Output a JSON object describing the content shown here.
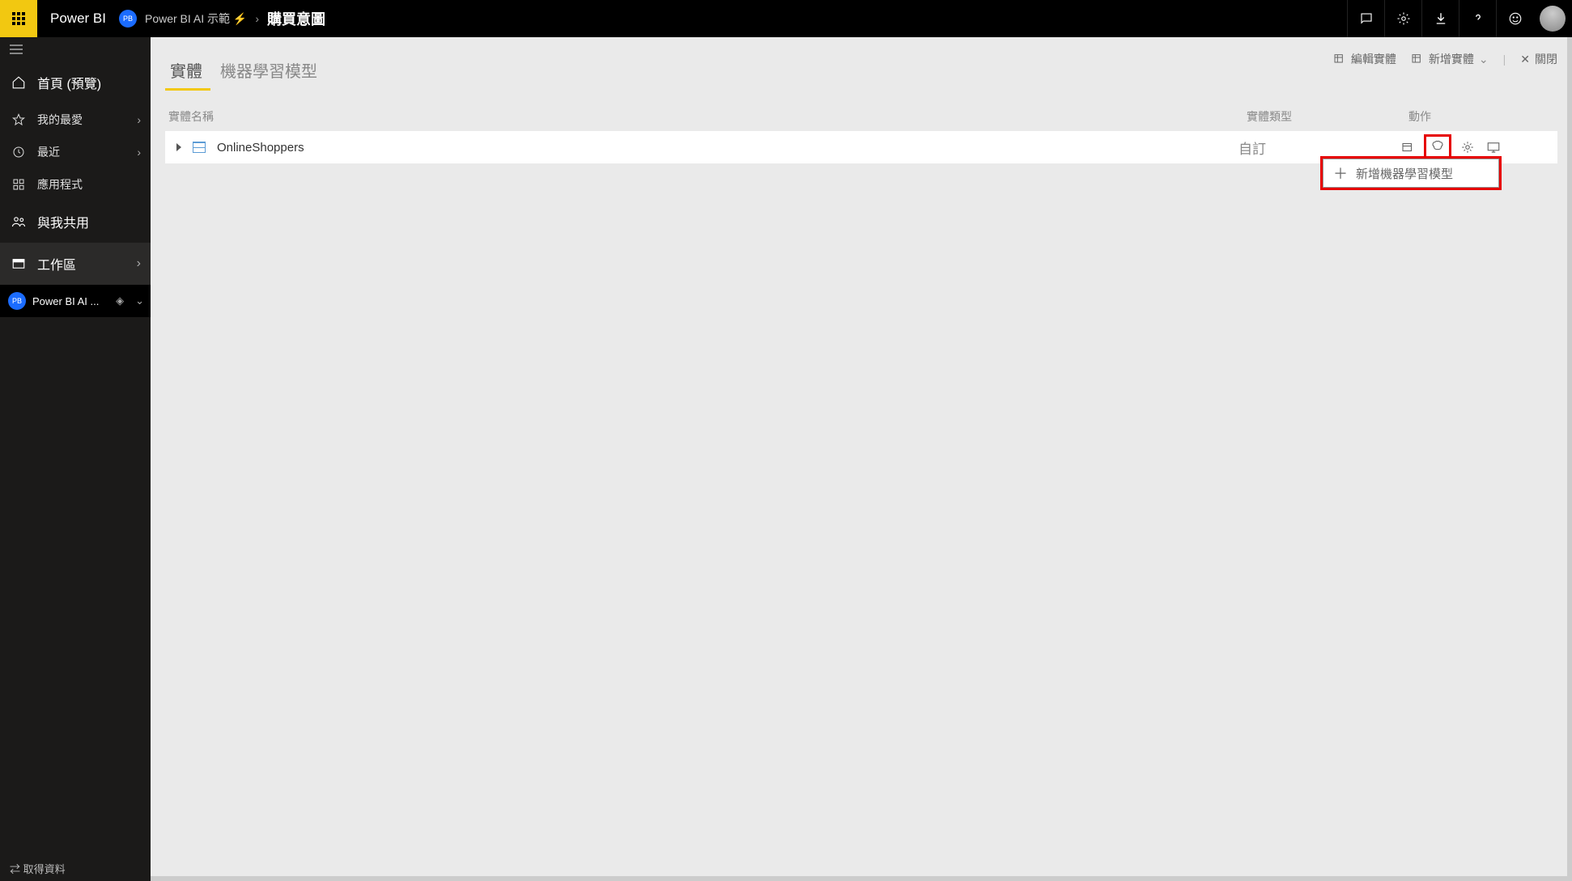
{
  "topbar": {
    "app_name": "Power BI",
    "breadcrumb_badge": "PB",
    "breadcrumb_workspace": "Power BI AI 示範 ⚡",
    "breadcrumb_sep": "›",
    "page_title": "購買意圖"
  },
  "sidebar": {
    "home": "首頁 (預覽)",
    "favorites": "我的最愛",
    "recent": "最近",
    "apps": "應用程式",
    "shared": "與我共用",
    "workspaces": "工作區",
    "current_ws_badge": "PB",
    "current_ws": "Power BI AI ...",
    "footer_num": "⇄",
    "footer_label": "取得資料"
  },
  "action_bar": {
    "edit": "編輯實體",
    "add": "新增實體",
    "close": "關閉"
  },
  "tabs": {
    "entities": "實體",
    "ml": "機器學習模型"
  },
  "headers": {
    "name": "實體名稱",
    "type": "實體類型",
    "actions": "動作"
  },
  "row": {
    "name": "OnlineShoppers",
    "type": "自訂"
  },
  "dropdown": {
    "add_ml": "新增機器學習模型"
  }
}
